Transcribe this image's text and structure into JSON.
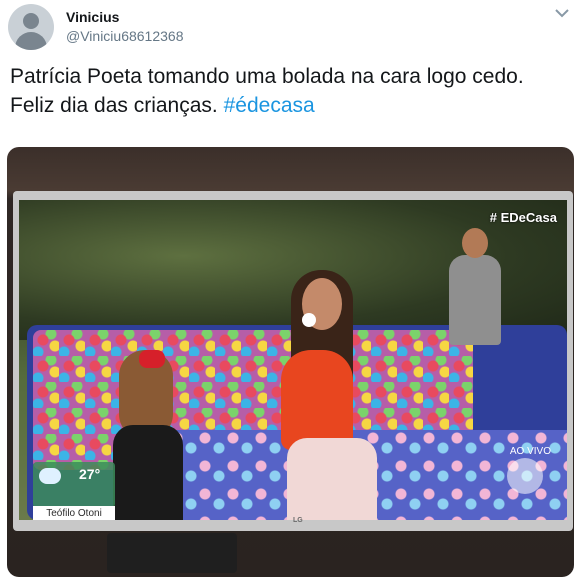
{
  "tweet": {
    "display_name": "Vinicius",
    "handle": "@Viniciu68612368",
    "text_line1": "Patrícia Poeta tomando uma bolada na cara logo cedo.",
    "text_line2": "Feliz dia das crianças.",
    "hashtag": "#édecasa"
  },
  "photo": {
    "tv_overlay": {
      "show_tag": "# EDeCasa",
      "weather_temp": "27°",
      "weather_city": "Teófilo Otoni",
      "corner_label": "AO VIVO",
      "tv_brand": "LG"
    }
  },
  "icons": {
    "avatar": "default-profile-icon",
    "caret": "chevron-down-icon"
  },
  "colors": {
    "text": "#14171a",
    "secondary": "#657786",
    "link": "#1b95e0"
  }
}
